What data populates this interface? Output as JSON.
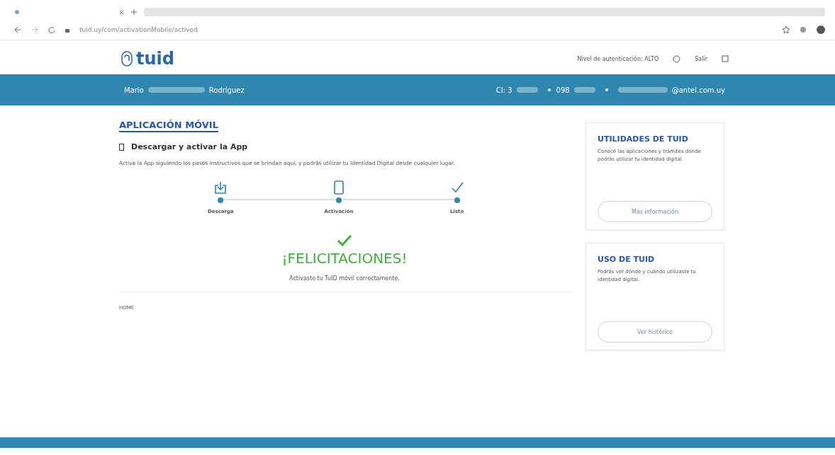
{
  "browser": {
    "url": "tuid.uy/com/activationMobile/actived"
  },
  "header": {
    "logo": "tuid",
    "auth_level": "Nivel de autenticación: ALTO",
    "logout": "Salir"
  },
  "user_bar": {
    "first_name": "Mario",
    "last_name": "Rodríguez",
    "ci": "CI: 3",
    "phone": "098",
    "email": "@antel.com.uy"
  },
  "main": {
    "title": "APLICACIÓN MÓVIL",
    "subtitle": "Descargar y activar la App",
    "description": "Activa la App siguiendo los pasos instructivos que se brindan aquí, y podrás utilizar tu Identidad Digital desde cualquier lugar.",
    "steps": [
      {
        "kind": "download",
        "label": "Descarga",
        "done": true
      },
      {
        "kind": "phone",
        "label": "Activación",
        "done": true
      },
      {
        "kind": "check",
        "label": "Listo",
        "done": true
      }
    ],
    "success_title": "¡FELICITACIONES!",
    "success_message": "Activaste tu TuID móvil correctamente.",
    "breadcrumb": "HOME"
  },
  "cards": [
    {
      "title": "UTILIDADES DE TUID",
      "text": "Conocé las aplicaciones y trámites donde podrás utilizar tu identidad digital.",
      "button": "Más información"
    },
    {
      "title": "USO DE TUID",
      "text": "Podrás ver dónde y cuándo utilizaste tu identidad digital.",
      "button": "Ver histórico"
    }
  ]
}
